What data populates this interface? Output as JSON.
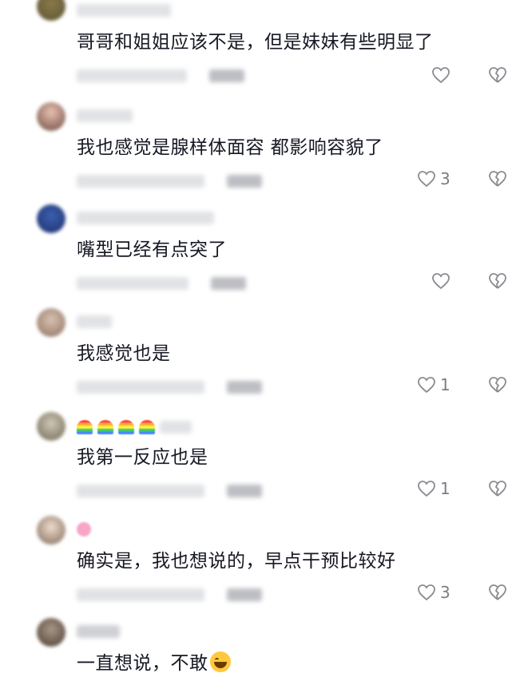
{
  "comments": [
    {
      "text": "哥哥和姐姐应该不是，但是妹妹有些明显了",
      "likes": ""
    },
    {
      "text": "我也感觉是腺样体面容  都影响容貌了",
      "likes": "3"
    },
    {
      "text": "嘴型已经有点突了",
      "likes": ""
    },
    {
      "text": "我感觉也是",
      "likes": "1"
    },
    {
      "text": "我第一反应也是",
      "likes": "1"
    },
    {
      "text": "确实是，我也想说的，早点干预比较好",
      "likes": "3"
    },
    {
      "text": "一直想说，不敢",
      "likes": ""
    }
  ],
  "icons": {
    "like": "heart-outline-icon",
    "dislike": "broken-heart-outline-icon",
    "emoji": "rofl-emoji-icon"
  },
  "colors": {
    "text": "#161823",
    "meta": "#7c7d82"
  }
}
